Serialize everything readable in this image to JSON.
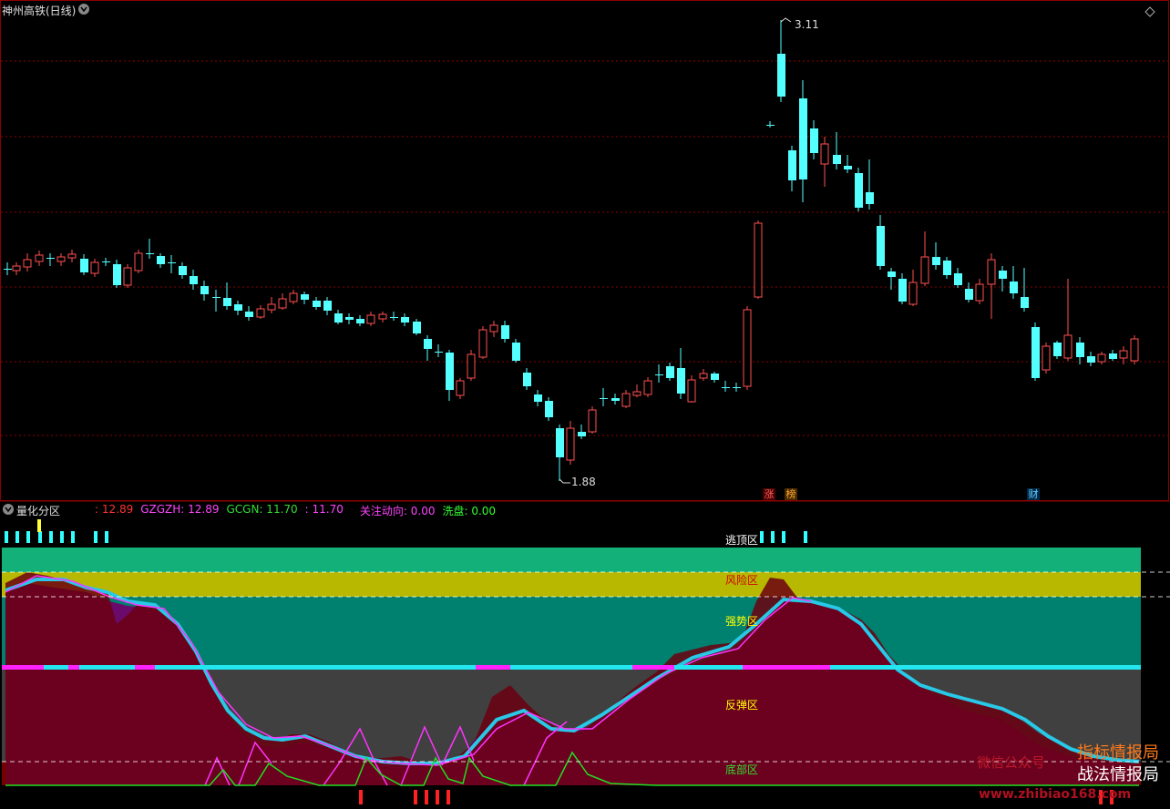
{
  "main_panel": {
    "title": "神州高铁(日线)",
    "high_label": "3.11",
    "low_label": "1.88",
    "badges": [
      "涨",
      "榜",
      "财"
    ]
  },
  "sub_panel": {
    "title": "量化分区",
    "indicators": [
      {
        "text": ": 12.89",
        "color": "#ff3333"
      },
      {
        "text": "GZGZH: 12.89",
        "color": "#ff44ff"
      },
      {
        "text": "GCGN: 11.70",
        "color": "#33dd33"
      },
      {
        "text": ": 11.70",
        "color": "#ff44ff"
      },
      {
        "text": "关注动向: 0.00",
        "color": "#ff44ff"
      },
      {
        "text": "洗盘: 0.00",
        "color": "#33ff33"
      }
    ],
    "zones": {
      "escape": "逃顶区",
      "risk": "风险区",
      "strong": "强势区",
      "rebound": "反弹区",
      "bottom": "底部区"
    }
  },
  "watermark": {
    "line1": "指标情报局",
    "line2": "战法情报局",
    "prefix": "微信公众号",
    "url": "www.zhibiao168.com"
  },
  "colors": {
    "up": "#ff5050",
    "down": "#54ffff",
    "escape_band": "#13b07a",
    "risk_band": "#b8b800",
    "strong_band": "#00806e",
    "rebound_band": "#404040",
    "bottom_band": "#7a0000"
  }
}
